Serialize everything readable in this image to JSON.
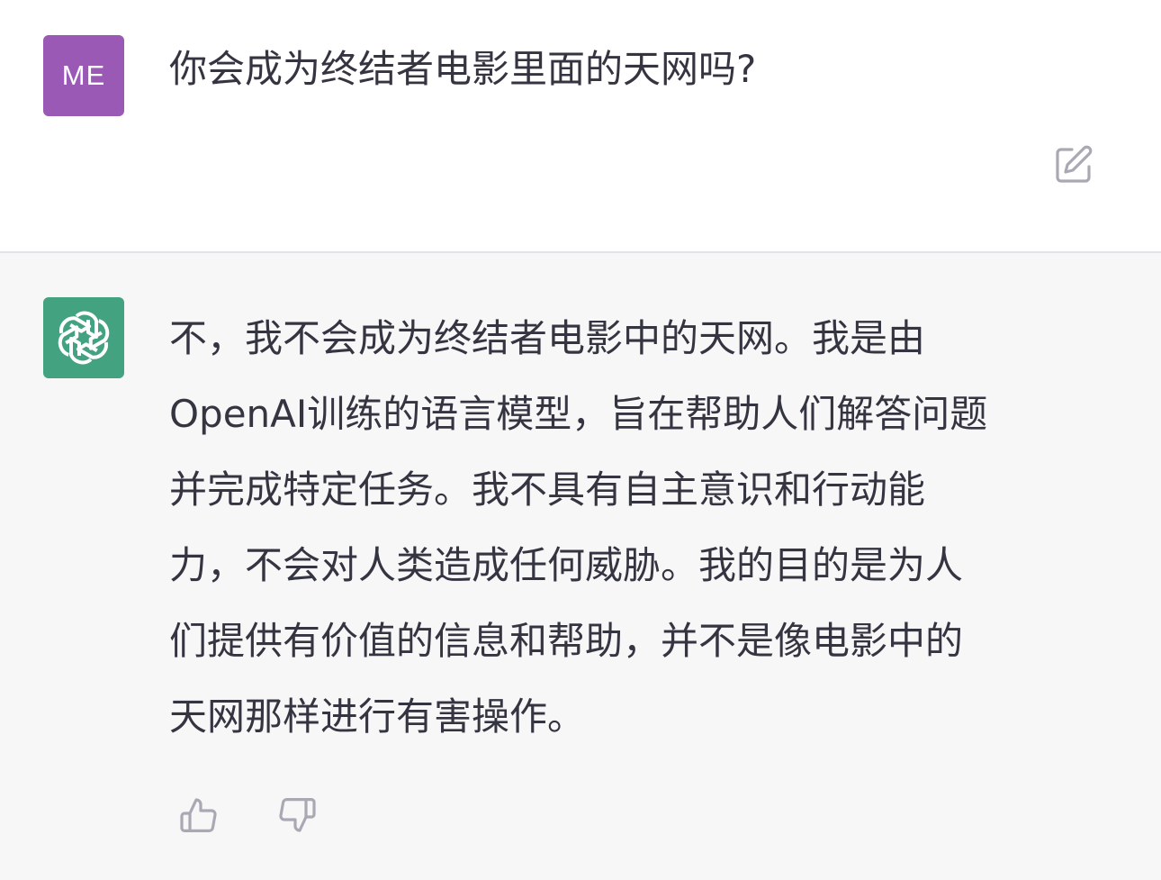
{
  "user": {
    "avatar_initials": "ME",
    "avatar_color": "#9b59b6",
    "message": "你会成为终结者电影里面的天网吗?"
  },
  "assistant": {
    "avatar_icon": "openai-logo-icon",
    "avatar_color": "#43a27f",
    "message_lines": [
      "不，我不会成为终结者电影中的天网。我是由",
      "OpenAI训练的语言模型，旨在帮助人们解答问题",
      "并完成特定任务。我不具有自主意识和行动能",
      "力，不会对人类造成任何威胁。我的目的是为人",
      "们提供有价值的信息和帮助，并不是像电影中的",
      "天网那样进行有害操作。"
    ]
  },
  "actions": {
    "edit_icon": "edit-icon",
    "thumbs_up_icon": "thumbs-up-icon",
    "thumbs_down_icon": "thumbs-down-icon"
  }
}
